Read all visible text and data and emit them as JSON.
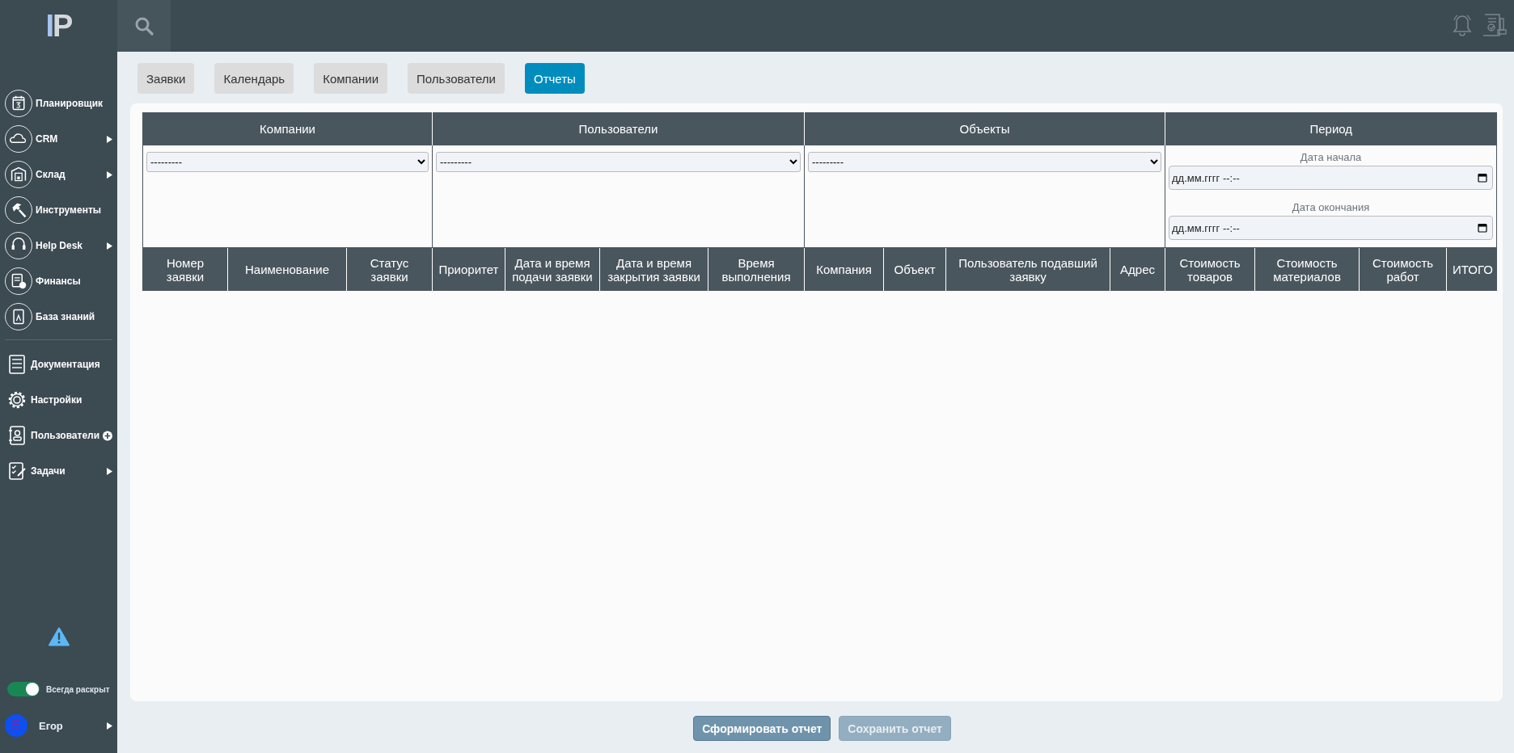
{
  "logo": {
    "letters": "IP"
  },
  "sidebar": {
    "items": [
      {
        "label": "Планировщик",
        "kind": "circle",
        "arrow": false,
        "add": false
      },
      {
        "label": "CRM",
        "kind": "circle",
        "arrow": true,
        "add": false
      },
      {
        "label": "Склад",
        "kind": "circle",
        "arrow": true,
        "add": false
      },
      {
        "label": "Инструменты",
        "kind": "circle",
        "arrow": false,
        "add": false
      },
      {
        "label": "Help Desk",
        "kind": "circle",
        "arrow": true,
        "add": false
      },
      {
        "label": "Финансы",
        "kind": "circle",
        "arrow": false,
        "add": false
      },
      {
        "label": "База знаний",
        "kind": "circle",
        "arrow": false,
        "add": false
      },
      {
        "label": "Документация",
        "kind": "plain",
        "arrow": false,
        "add": false
      },
      {
        "label": "Настройки",
        "kind": "plain",
        "arrow": false,
        "add": false
      },
      {
        "label": "Пользователи",
        "kind": "plain",
        "arrow": false,
        "add": true
      },
      {
        "label": "Задачи",
        "kind": "plain",
        "arrow": true,
        "add": false
      }
    ],
    "always_expanded": {
      "label": "Всегда раскрыт",
      "on": true
    },
    "user": {
      "initial": "Е",
      "name": "Егор"
    }
  },
  "tabs": [
    {
      "label": "Заявки",
      "selected": false
    },
    {
      "label": "Календарь",
      "selected": false
    },
    {
      "label": "Компании",
      "selected": false
    },
    {
      "label": "Пользователи",
      "selected": false
    },
    {
      "label": "Отчеты",
      "selected": true
    }
  ],
  "filters": [
    {
      "title": "Компании",
      "kind": "select",
      "value": "---------"
    },
    {
      "title": "Пользователи",
      "kind": "select",
      "value": "---------"
    },
    {
      "title": "Объекты",
      "kind": "select",
      "value": "---------"
    },
    {
      "title": "Период",
      "kind": "period",
      "start_label": "Дата начала",
      "start_placeholder": "дд.мм.гггг --:--",
      "end_label": "Дата окончания",
      "end_placeholder": "дд.мм.гггг --:--"
    }
  ],
  "table": {
    "columns": [
      "Номер заявки",
      "Наименование",
      "Статус заявки",
      "Приоритет",
      "Дата и время подачи заявки",
      "Дата и время закрытия заявки",
      "Время выполнения",
      "Компания",
      "Объект",
      "Пользователь подавший заявку",
      "Адрес",
      "Стоимость товаров",
      "Стоимость материалов",
      "Стоимость работ",
      "ИТОГО"
    ]
  },
  "buttons": [
    {
      "label": "Сформировать отчет",
      "disabled": false
    },
    {
      "label": "Сохранить отчет",
      "disabled": true
    }
  ]
}
